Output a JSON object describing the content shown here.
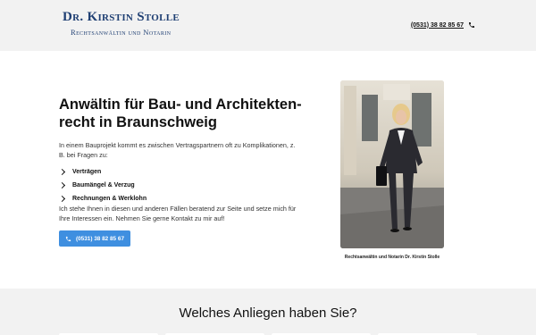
{
  "header": {
    "brand_name": "Dr. Kirstin Stolle",
    "brand_subtitle": "Rechtsanwältin und Notarin",
    "phone": "(0531) 38 82 85 67",
    "phone_icon": "phone-icon"
  },
  "hero": {
    "headline": "Anwältin für Bau- und Architekten­recht in Braunschweig",
    "intro": "In einem Bauprojekt kommt es zwischen Vertragspartnern oft zu Komplikationen, z. B. bei Fragen zu:",
    "bullets": [
      "Verträgen",
      "Baumängel & Verzug",
      "Rechnungen & Werklohn"
    ],
    "outro": "Ich stehe Ihnen in diesen und anderen Fällen beratend zur Seite und setze mich für Ihre Interessen ein. Nehmen Sie gerne Kontakt zu mir auf!",
    "cta_label": "(0531) 38 82 85 67",
    "photo_caption": "Rechtsanwältin und Notarin Dr. Kirstin Stolle"
  },
  "section2": {
    "title": "Welches Anliegen haben Sie?"
  },
  "colors": {
    "brand": "#1f3f73",
    "accent": "#3f8fe0",
    "band": "#f2f2f2"
  }
}
